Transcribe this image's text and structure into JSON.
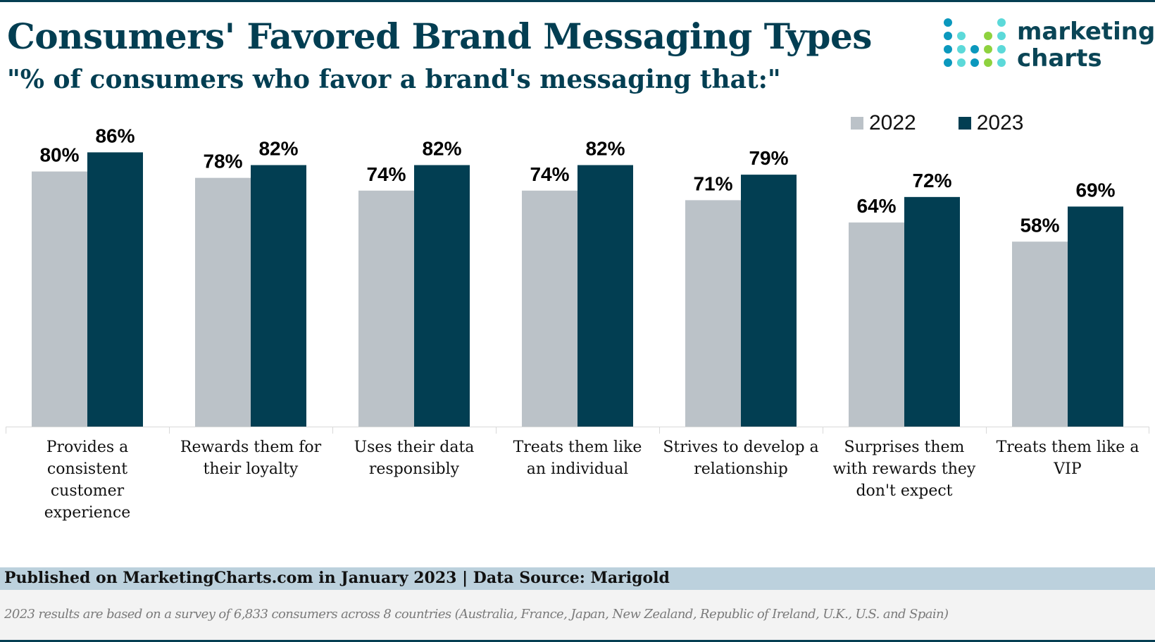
{
  "header": {
    "title": "Consumers' Favored Brand Messaging Types",
    "subtitle": "\"% of consumers who favor a brand's messaging that:\""
  },
  "logo": {
    "line1": "marketing",
    "line2": "charts",
    "dot_colors": [
      "#0b98bd",
      "#5cd9d9",
      "#8ed23e"
    ]
  },
  "colors": {
    "series_2022": "#bbc2c8",
    "series_2023": "#023e52",
    "title": "#023e52"
  },
  "footer": {
    "published": "Published on MarketingCharts.com in January 2023 | Data Source: Marigold",
    "note": "2023 results are based on a survey of 6,833 consumers across 8 countries (Australia, France, Japan, New Zealand, Republic of Ireland, U.K., U.S. and Spain)"
  },
  "chart_data": {
    "type": "bar",
    "title": "Consumers' Favored Brand Messaging Types",
    "subtitle": "\"% of consumers who favor a brand's messaging that:\"",
    "xlabel": "",
    "ylabel": "",
    "ylim": [
      0,
      100
    ],
    "grid": false,
    "legend_position": "top-right",
    "value_format": "percent",
    "categories": [
      [
        "Provides a",
        "consistent",
        "customer",
        "experience"
      ],
      [
        "Rewards them for",
        "their loyalty"
      ],
      [
        "Uses their data",
        "responsibly"
      ],
      [
        "Treats them like",
        "an individual"
      ],
      [
        "Strives to develop a",
        "relationship"
      ],
      [
        "Surprises them",
        "with rewards they",
        "don't expect"
      ],
      [
        "Treats them like a",
        "VIP"
      ]
    ],
    "series": [
      {
        "name": "2022",
        "color": "#bbc2c8",
        "values": [
          80,
          78,
          74,
          74,
          71,
          64,
          58
        ]
      },
      {
        "name": "2023",
        "color": "#023e52",
        "values": [
          86,
          82,
          82,
          82,
          79,
          72,
          69
        ]
      }
    ]
  }
}
